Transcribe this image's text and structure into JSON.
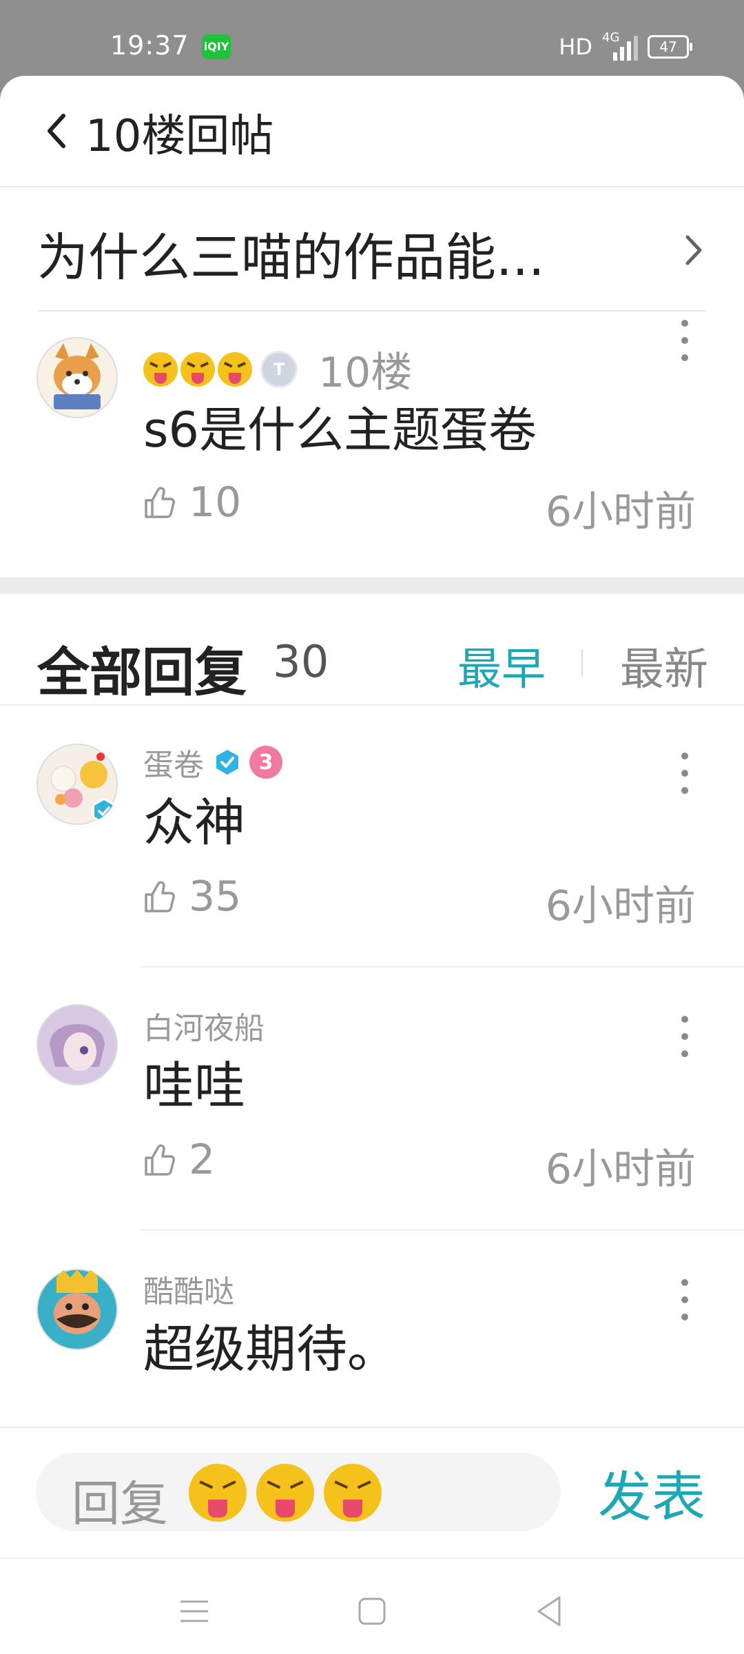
{
  "status_bar": {
    "time": "19:37",
    "hd": "HD",
    "network": "4G",
    "battery": "47"
  },
  "header": {
    "title": "10楼回帖"
  },
  "post": {
    "title": "为什么三喵的作品能..."
  },
  "floor": {
    "floor_label": "10楼",
    "level_badge": "T",
    "text": "s6是什么主题蛋卷",
    "likes": "10",
    "time": "6小时前"
  },
  "replies_header": {
    "title": "全部回复",
    "count": "30",
    "sort_earliest": "最早",
    "sort_latest": "最新"
  },
  "replies": [
    {
      "name": "蛋卷",
      "text": "众神",
      "likes": "35",
      "time": "6小时前",
      "rank_badge": "3"
    },
    {
      "name": "白河夜船",
      "text": "哇哇",
      "likes": "2",
      "time": "6小时前"
    },
    {
      "name": "酷酷哒",
      "text": "超级期待。"
    }
  ],
  "input_bar": {
    "placeholder": "回复",
    "submit": "发表"
  },
  "colors": {
    "accent": "#1ea8b4",
    "muted": "#999999"
  }
}
